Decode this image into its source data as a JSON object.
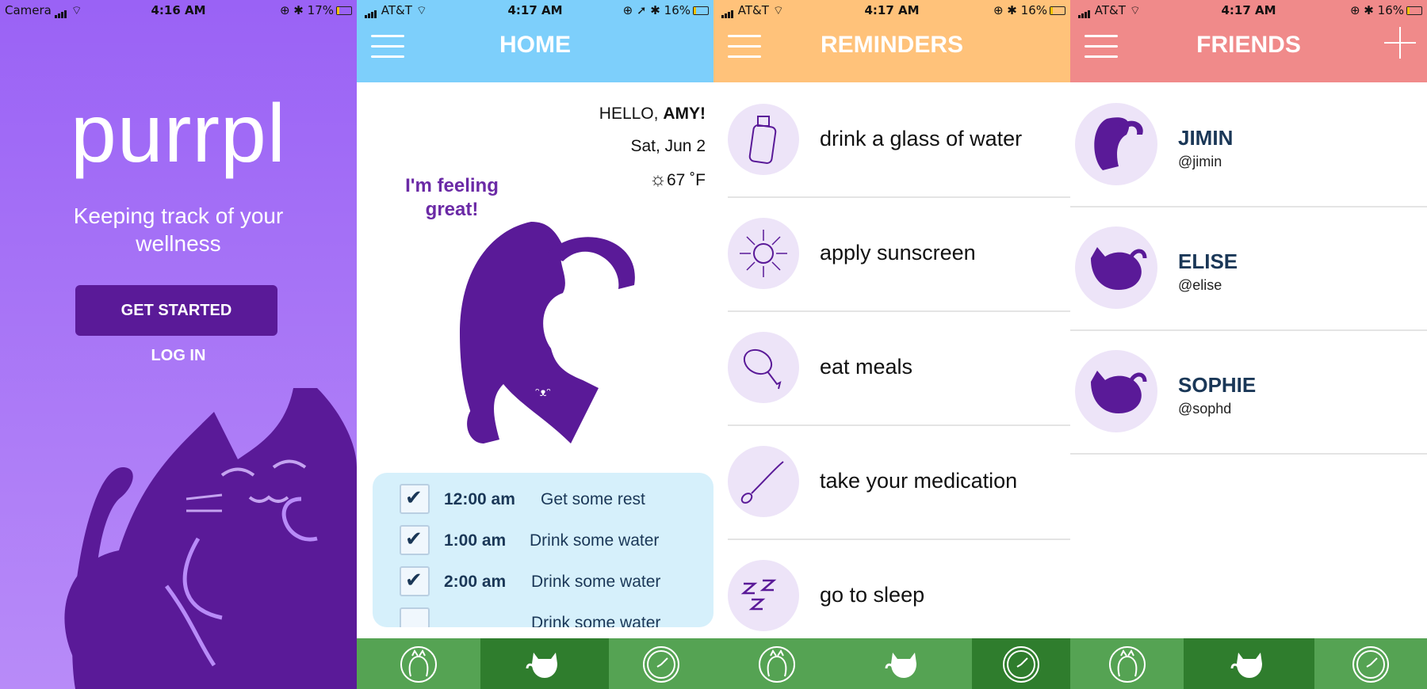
{
  "screens": {
    "welcome": {
      "status": {
        "carrier": "Camera",
        "time": "4:16 AM",
        "battery": "17%"
      },
      "logo": "purrpl",
      "tagline": "Keeping track of your wellness",
      "get_started": "GET STARTED",
      "log_in": "LOG IN"
    },
    "home": {
      "status": {
        "carrier": "AT&T",
        "time": "4:17 AM",
        "battery": "16%"
      },
      "title": "HOME",
      "hello_prefix": "HELLO, ",
      "user_name": "AMY!",
      "date": "Sat, Jun 2",
      "temperature": "67 ˚F",
      "feeling": "I'm feeling great!",
      "tasks": [
        {
          "time": "12:00 am",
          "text": "Get some rest",
          "checked": true
        },
        {
          "time": "1:00 am",
          "text": "Drink some water",
          "checked": true
        },
        {
          "time": "2:00 am",
          "text": "Drink some water",
          "checked": true
        },
        {
          "time": "",
          "text": "Drink some water",
          "checked": false
        }
      ]
    },
    "reminders": {
      "status": {
        "carrier": "AT&T",
        "time": "4:17 AM",
        "battery": "16%"
      },
      "title": "REMINDERS",
      "items": [
        {
          "label": "drink a glass of water",
          "icon": "water-bottle-icon"
        },
        {
          "label": "apply sunscreen",
          "icon": "sun-icon"
        },
        {
          "label": "eat meals",
          "icon": "drumstick-icon"
        },
        {
          "label": "take your medication",
          "icon": "spoon-icon"
        },
        {
          "label": "go to sleep",
          "icon": "zzz-icon"
        }
      ]
    },
    "friends": {
      "status": {
        "carrier": "AT&T",
        "time": "4:17 AM",
        "battery": "16%"
      },
      "title": "FRIENDS",
      "items": [
        {
          "name": "JIMIN",
          "handle": "@jimin"
        },
        {
          "name": "ELISE",
          "handle": "@elise"
        },
        {
          "name": "SOPHIE",
          "handle": "@sophd"
        }
      ]
    }
  },
  "colors": {
    "purple_dark": "#5a1a98",
    "home_header": "#7dcffb",
    "reminders_header": "#ffc27a",
    "friends_header": "#f08a8a",
    "tabbar": "#55a353",
    "tab_active": "#2f7d2d",
    "navy": "#1a3757"
  },
  "tab_icons": [
    "cat-meditate-icon",
    "cat-wave-icon",
    "clock-icon"
  ]
}
